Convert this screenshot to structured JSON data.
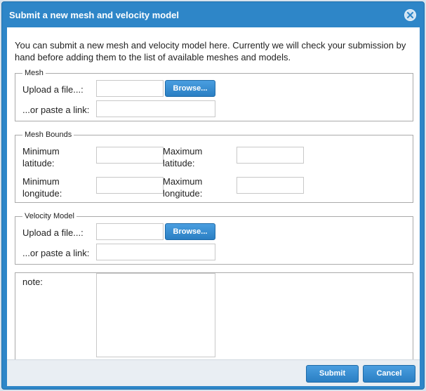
{
  "dialog": {
    "title": "Submit a new mesh and velocity model",
    "intro": "You can submit a new mesh and velocity model here. Currently we will check your submission by hand before adding them to the list of available meshes and models."
  },
  "mesh": {
    "legend": "Mesh",
    "upload_label": "Upload a file...:",
    "browse_label": "Browse...",
    "link_label": "...or paste a link:"
  },
  "bounds": {
    "legend": "Mesh Bounds",
    "min_lat_line1": "Minimum",
    "min_lat_line2": "latitude:",
    "max_lat_line1": "Maximum",
    "max_lat_line2": "latitude:",
    "min_lon_line1": "Minimum",
    "min_lon_line2": "longitude:",
    "max_lon_line1": "Maximum",
    "max_lon_line2": "longitude:"
  },
  "velocity": {
    "legend": "Velocity Model",
    "upload_label": "Upload a file...:",
    "browse_label": "Browse...",
    "link_label": "...or paste a link:"
  },
  "note": {
    "label": "note:"
  },
  "footer": {
    "submit_label": "Submit",
    "cancel_label": "Cancel"
  },
  "colors": {
    "titlebar": "#2e86c8",
    "button": "#2a7fc3",
    "footer": "#e9eef3"
  },
  "icons": {
    "close": "close-icon"
  }
}
